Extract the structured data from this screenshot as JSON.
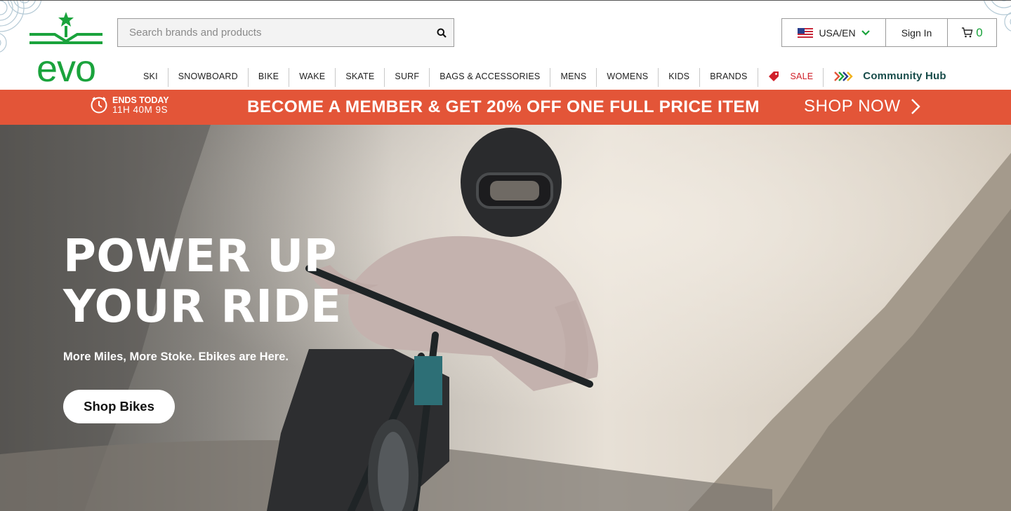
{
  "header": {
    "logo_text": "evo",
    "search": {
      "placeholder": "Search brands and products",
      "value": ""
    },
    "locale_label": "USA/EN",
    "signin_label": "Sign In",
    "cart_count": "0"
  },
  "nav": {
    "items": [
      "SKI",
      "SNOWBOARD",
      "BIKE",
      "WAKE",
      "SKATE",
      "SURF",
      "BAGS & ACCESSORIES",
      "MENS",
      "WOMENS",
      "KIDS",
      "BRANDS"
    ],
    "sale_label": "SALE",
    "community_label": "Community Hub"
  },
  "promo": {
    "timer_label": "ENDS TODAY",
    "timer_value": "11H 40M 9S",
    "message": "BECOME A MEMBER & GET 20% OFF ONE FULL PRICE ITEM",
    "cta": "SHOP NOW"
  },
  "hero": {
    "title_line1": "POWER UP",
    "title_line2": "YOUR RIDE",
    "subtitle": "More Miles, More Stoke. Ebikes are Here.",
    "button": "Shop Bikes"
  },
  "colors": {
    "brand_green": "#1aa33c",
    "promo_bg": "#e35538",
    "sale_red": "#d0202a",
    "community_teal": "#184c4a"
  },
  "icons": [
    "search-icon",
    "us-flag-icon",
    "chevron-down-icon",
    "cart-icon",
    "clock-icon",
    "chevron-right-icon",
    "sale-tag-icon",
    "community-hub-icon"
  ]
}
